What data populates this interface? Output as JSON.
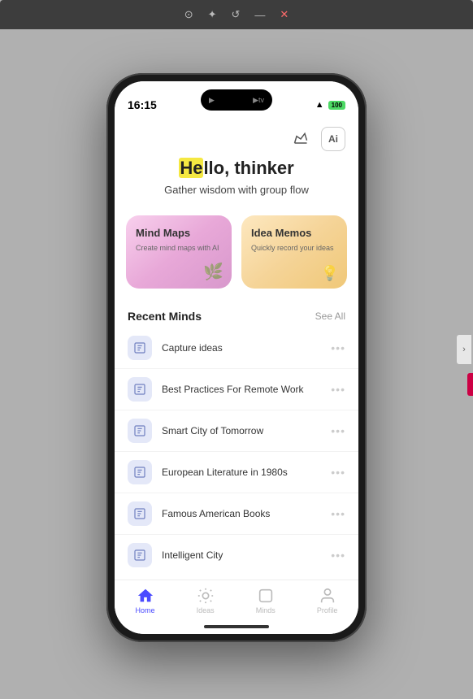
{
  "browser": {
    "toolbar_icons": [
      "portrait",
      "star",
      "refresh",
      "minimize",
      "close"
    ]
  },
  "status_bar": {
    "time": "16:15",
    "apple_tv": "▶tv",
    "wifi": "WiFi",
    "battery": "100"
  },
  "hero": {
    "title_prefix": "",
    "title_highlight": "He",
    "title_rest": "llo, thinker",
    "subtitle": "Gather wisdom with group flow"
  },
  "cards": [
    {
      "id": "mind-maps",
      "title": "Mind Maps",
      "description": "Create mind maps with AI",
      "icon": "🌿"
    },
    {
      "id": "idea-memos",
      "title": "Idea Memos",
      "description": "Quickly record your ideas",
      "icon": "💡"
    }
  ],
  "recent": {
    "section_title": "Recent Minds",
    "see_all": "See All",
    "items": [
      {
        "id": 1,
        "title": "Capture ideas"
      },
      {
        "id": 2,
        "title": "Best Practices For Remote Work"
      },
      {
        "id": 3,
        "title": "Smart City of Tomorrow"
      },
      {
        "id": 4,
        "title": "European Literature in 1980s"
      },
      {
        "id": 5,
        "title": "Famous American Books"
      },
      {
        "id": 6,
        "title": "Intelligent City"
      }
    ]
  },
  "nav": {
    "items": [
      {
        "id": "home",
        "label": "Home",
        "active": true
      },
      {
        "id": "ideas",
        "label": "Ideas",
        "active": false
      },
      {
        "id": "minds",
        "label": "Minds",
        "active": false
      },
      {
        "id": "profile",
        "label": "Profile",
        "active": false
      }
    ]
  },
  "action_icons": {
    "crown": "♛",
    "ai": "Ai"
  }
}
